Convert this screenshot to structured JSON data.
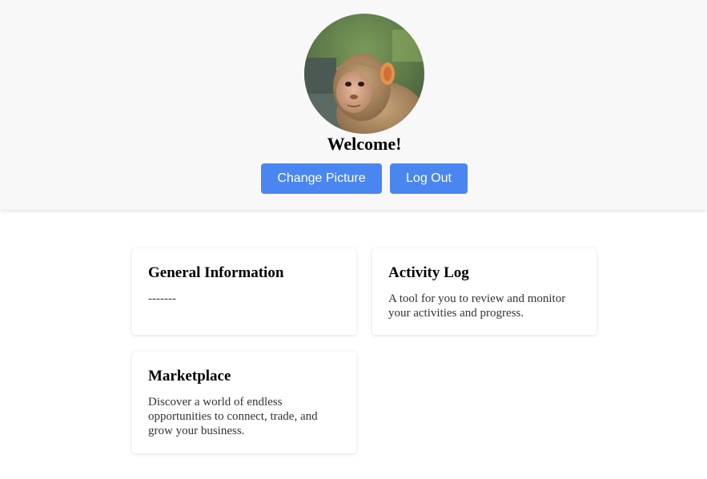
{
  "header": {
    "welcome": "Welcome!",
    "change_picture_label": "Change Picture",
    "logout_label": "Log Out",
    "avatar_subject": "monkey-photo",
    "accent_color": "#4a86f0"
  },
  "cards": [
    {
      "title": "General Information",
      "text": "-------"
    },
    {
      "title": "Activity Log",
      "text": "A tool for you to review and monitor your activities and progress."
    },
    {
      "title": "Marketplace",
      "text": "Discover a world of endless opportunities to connect, trade, and grow your business."
    }
  ]
}
